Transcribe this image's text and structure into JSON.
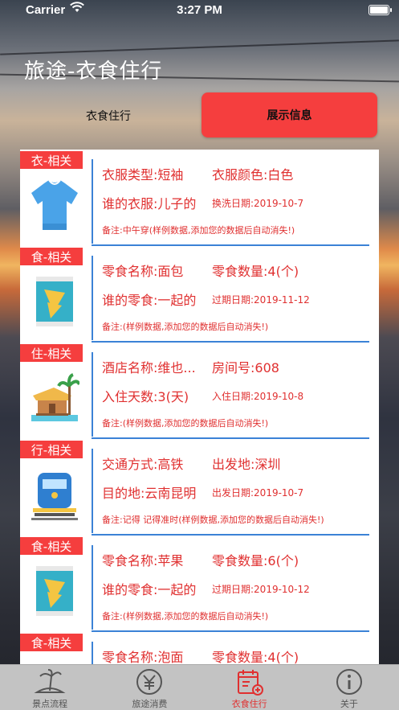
{
  "status_bar": {
    "carrier": "Carrier",
    "time": "3:27 PM"
  },
  "page_title": "旅途-衣食住行",
  "segments": {
    "left": "衣食住行",
    "right": "展示信息"
  },
  "cards": [
    {
      "tag": "衣-相关",
      "icon": "tshirt-icon",
      "a": "衣服类型:短袖",
      "b": "衣服颜色:白色",
      "c": "谁的衣服:儿子的",
      "d": "换洗日期:2019-10-7",
      "note": "备注:中午穿(样例数据,添加您的数据后自动消失!)"
    },
    {
      "tag": "食-相关",
      "icon": "snack-bag-icon",
      "a": "零食名称:面包",
      "b": "零食数量:4(个)",
      "c": "谁的零食:一起的",
      "d": "过期日期:2019-11-12",
      "note": "备注:(样例数据,添加您的数据后自动消失!)"
    },
    {
      "tag": "住-相关",
      "icon": "beach-hut-icon",
      "a": "酒店名称:维也...",
      "b": "房间号:608",
      "c": "入住天数:3(天)",
      "d": "入住日期:2019-10-8",
      "note": "备注:(样例数据,添加您的数据后自动消失!)"
    },
    {
      "tag": "行-相关",
      "icon": "train-icon",
      "a": "交通方式:高铁",
      "b": "出发地:深圳",
      "c": "目的地:云南昆明",
      "d": "出发日期:2019-10-7",
      "note": "备注:记得 记得准时(样例数据,添加您的数据后自动消失!)"
    },
    {
      "tag": "食-相关",
      "icon": "snack-bag-icon",
      "a": "零食名称:苹果",
      "b": "零食数量:6(个)",
      "c": "谁的零食:一起的",
      "d": "过期日期:2019-10-12",
      "note": "备注:(样例数据,添加您的数据后自动消失!)"
    },
    {
      "tag": "食-相关",
      "icon": "snack-bag-icon",
      "a": "零食名称:泡面",
      "b": "零食数量:4(个)",
      "c": "",
      "d": "",
      "note": ""
    }
  ],
  "tabs": [
    {
      "label": "景点流程",
      "icon": "island-icon",
      "active": false
    },
    {
      "label": "旅途消费",
      "icon": "yen-icon",
      "active": false
    },
    {
      "label": "衣食住行",
      "icon": "calendar-add-icon",
      "active": true
    },
    {
      "label": "关于",
      "icon": "info-icon",
      "active": false
    }
  ],
  "colors": {
    "accent": "#f53e3e",
    "text_red": "#e03030",
    "divider_blue": "#3b82d6",
    "tab_bg": "#c3c3c3"
  }
}
